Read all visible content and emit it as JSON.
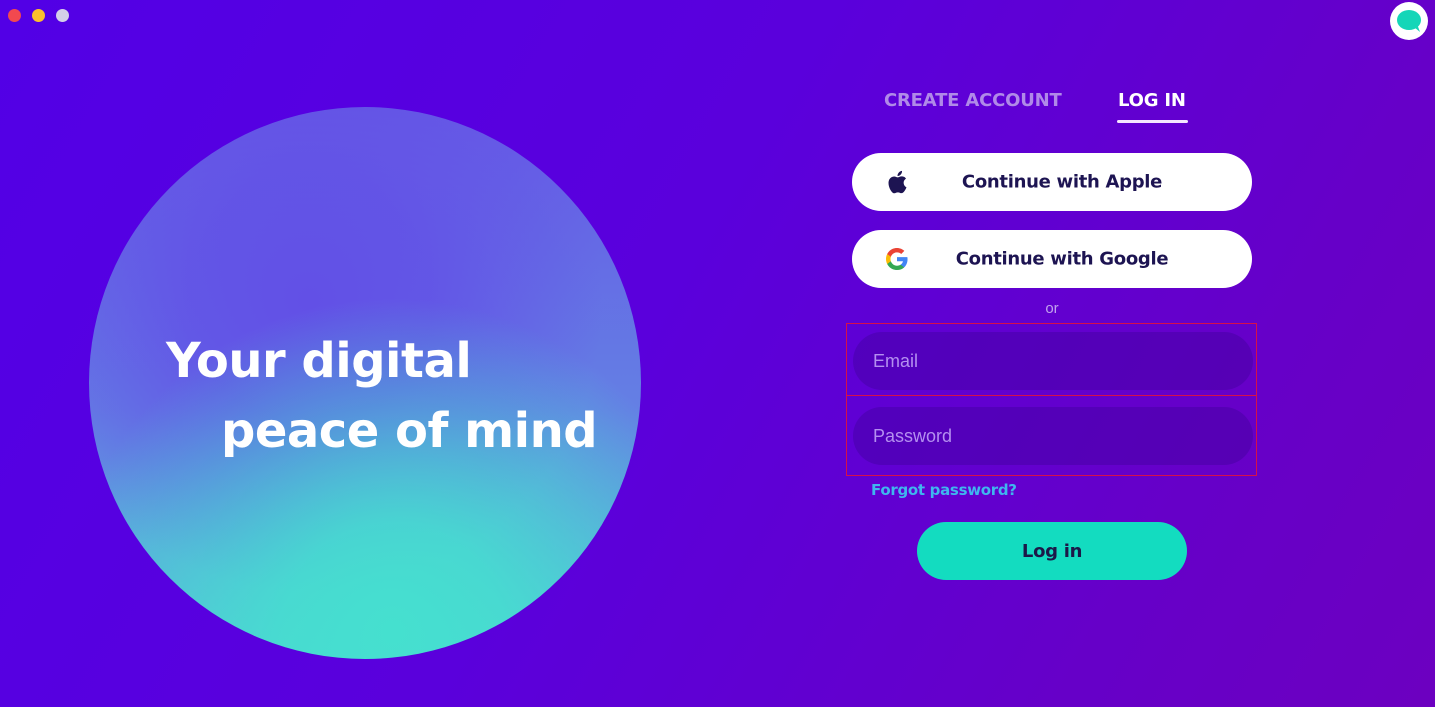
{
  "window": {
    "controls": [
      "close",
      "minimize",
      "maximize"
    ]
  },
  "app_badge": {
    "icon": "chat-bubble-icon",
    "color": "#14d6b8"
  },
  "hero": {
    "line1": "Your digital",
    "line2": "peace of mind"
  },
  "tabs": [
    {
      "label": "CREATE ACCOUNT",
      "active": false
    },
    {
      "label": "LOG IN",
      "active": true
    }
  ],
  "social": {
    "apple_label": "Continue with Apple",
    "google_label": "Continue with Google"
  },
  "divider_text": "or",
  "form": {
    "email": {
      "value": "",
      "placeholder": "Email"
    },
    "password": {
      "value": "",
      "placeholder": "Password"
    }
  },
  "forgot_password": "Forgot password?",
  "submit_label": "Log in",
  "colors": {
    "accent": "#13dcc0",
    "link": "#3fb6ee",
    "background": "#5a00dc",
    "highlight_outline": "#d6104a"
  }
}
